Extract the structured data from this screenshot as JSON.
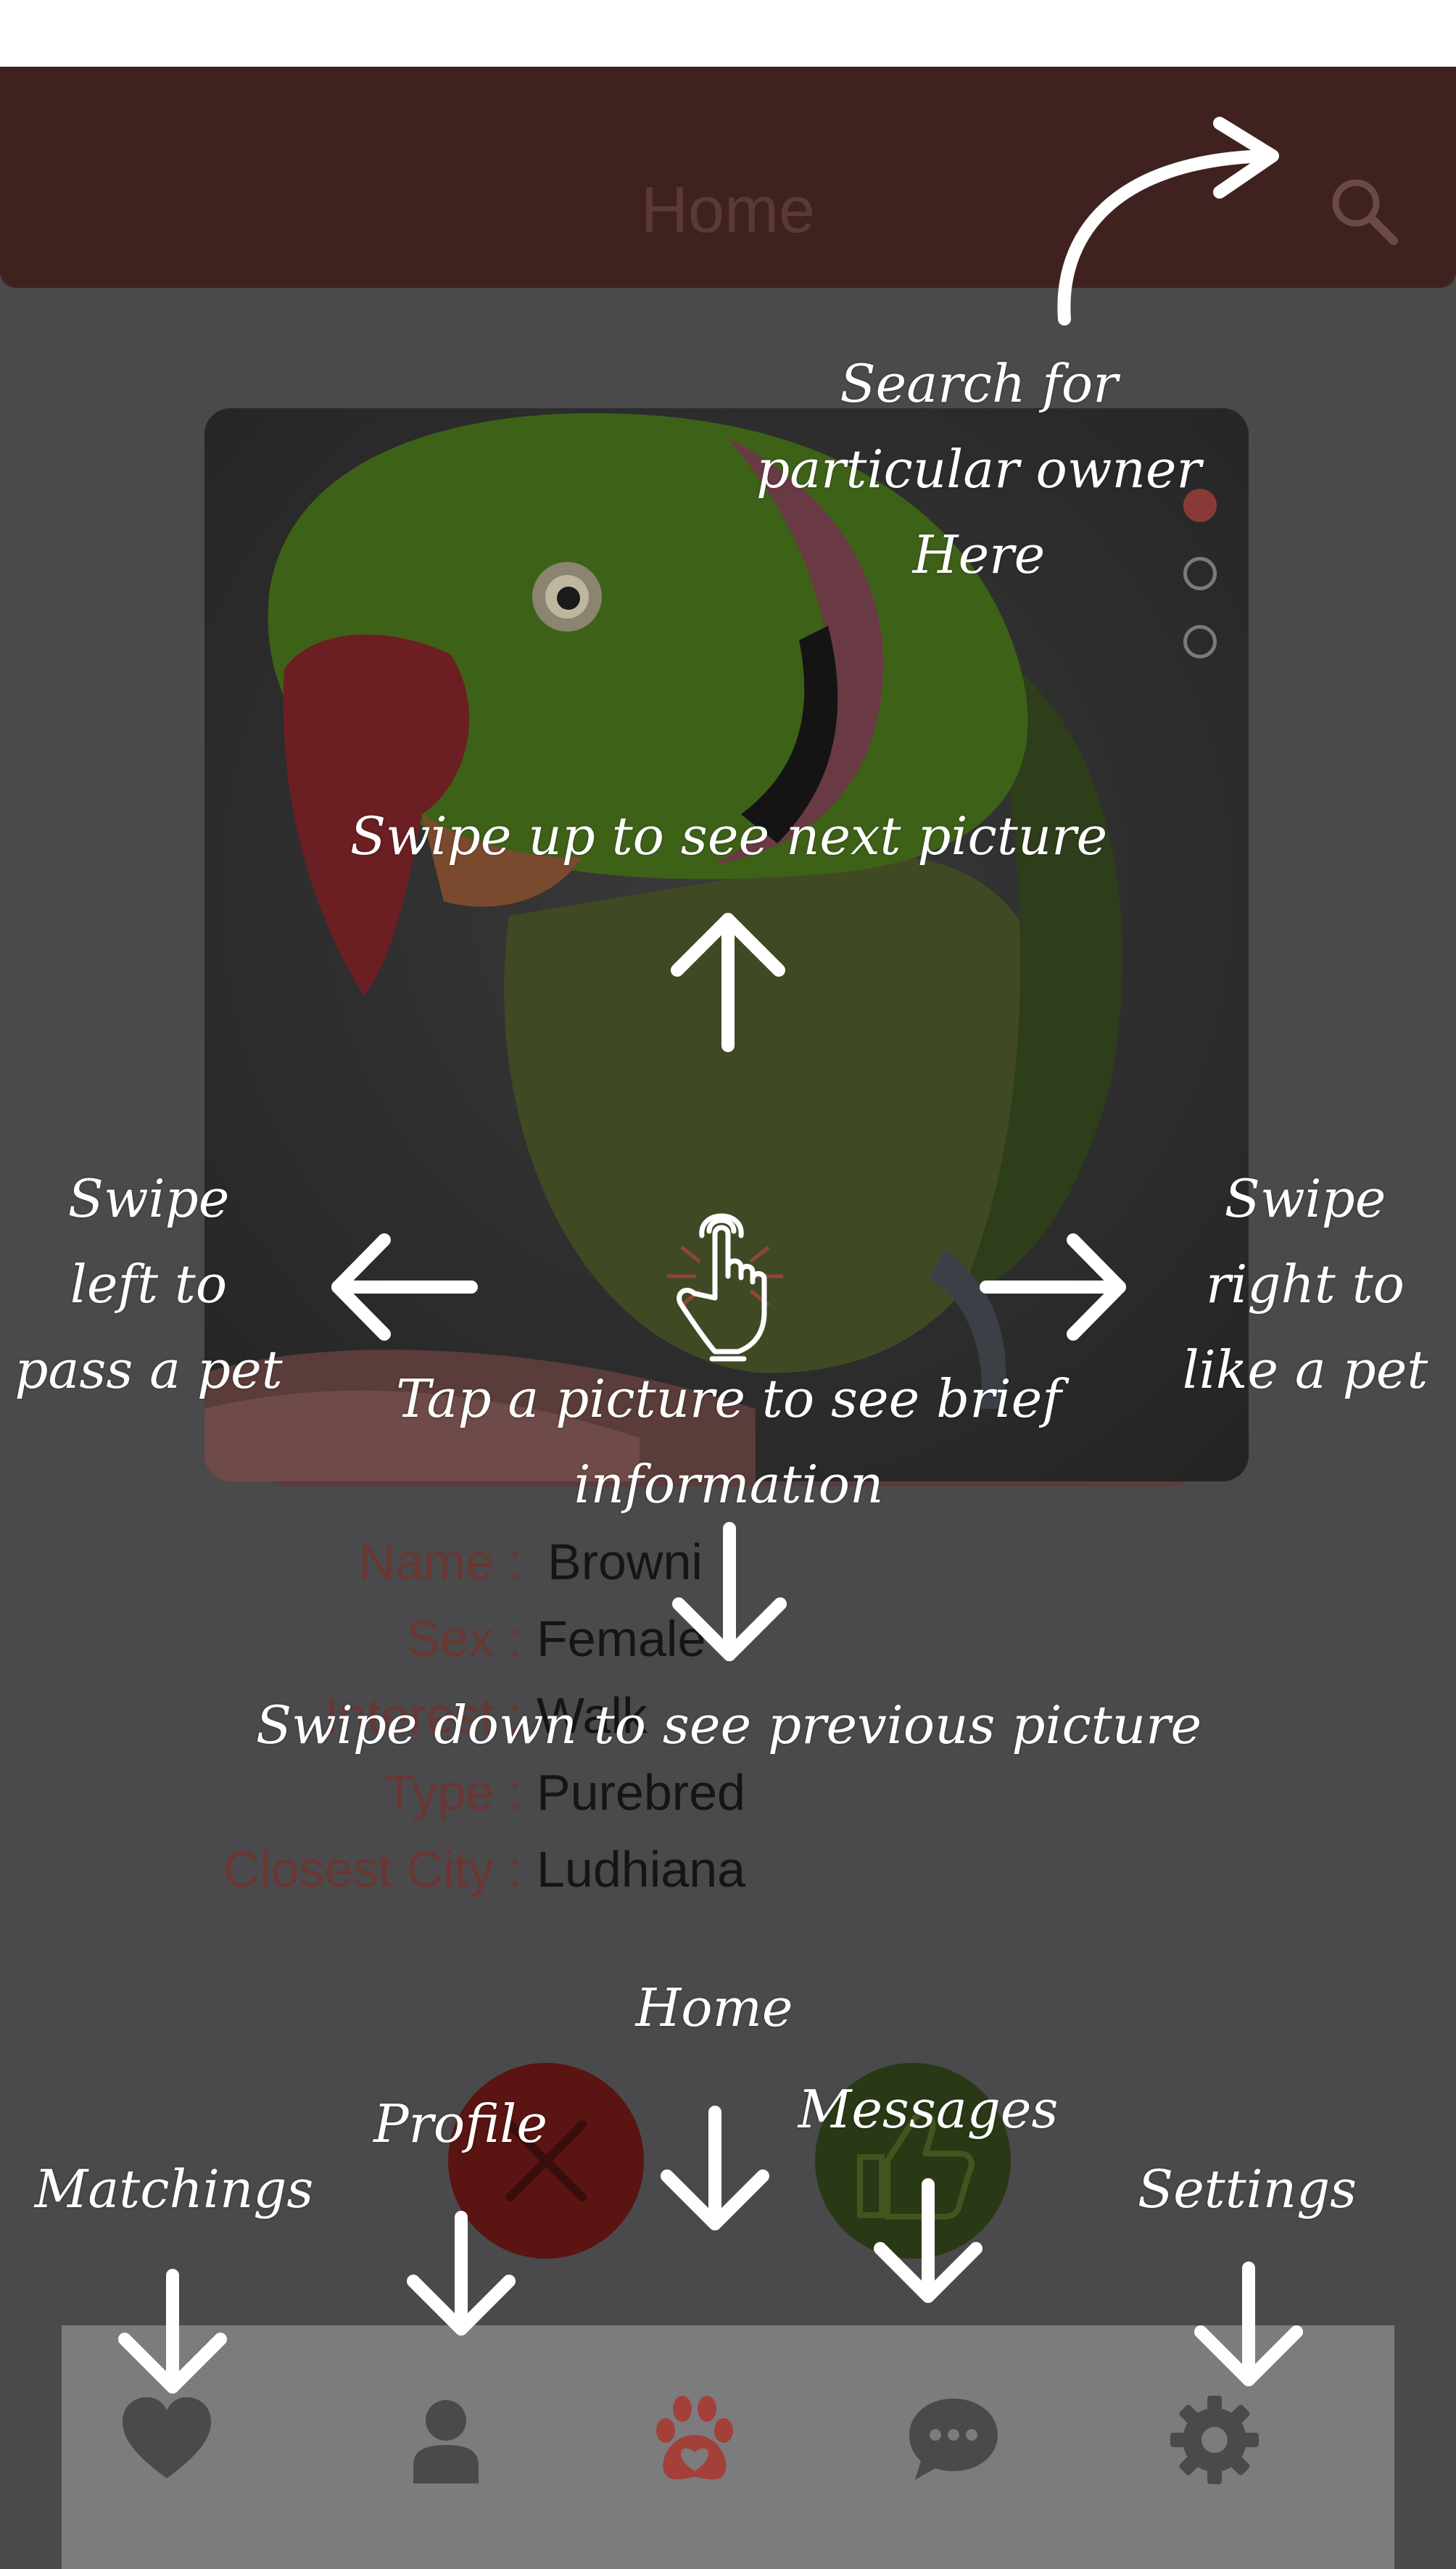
{
  "app": {
    "title": "Home",
    "accent_color": "#3f2220",
    "active_tab_color": "#a3403a"
  },
  "header": {
    "title": "Home",
    "search_icon": "search-icon"
  },
  "card": {
    "image_subject": "green parrot",
    "pagination": {
      "count": 3,
      "active_index": 0
    }
  },
  "pet_info": [
    {
      "label": "Name :",
      "value": "Browni"
    },
    {
      "label": "Sex :",
      "value": "Female"
    },
    {
      "label": "Interest :",
      "value": "Walk"
    },
    {
      "label": "Type :",
      "value": "Purebred"
    },
    {
      "label": "Closest City :",
      "value": "Ludhiana"
    }
  ],
  "actions": {
    "pass_icon": "close-icon",
    "like_icon": "thumbs-up-icon"
  },
  "tabbar": {
    "active": "home",
    "items": [
      {
        "id": "matchings",
        "icon": "heart-icon"
      },
      {
        "id": "profile",
        "icon": "user-icon"
      },
      {
        "id": "home",
        "icon": "paw-icon"
      },
      {
        "id": "messages",
        "icon": "chat-icon"
      },
      {
        "id": "settings",
        "icon": "gear-icon"
      }
    ]
  },
  "annotations": {
    "search": "Search for\nparticular owner\nHere",
    "swipe_up": "Swipe up to see next picture",
    "swipe_left": "Swipe\nleft to\npass a pet",
    "swipe_right": "Swipe\nright to\nlike a pet",
    "tap": "Tap a picture to see brief\ninformation",
    "swipe_down": "Swipe down to see previous picture",
    "tab_home": "Home",
    "tab_profile": "Profile",
    "tab_messages": "Messages",
    "tab_matchings": "Matchings",
    "tab_settings": "Settings"
  }
}
